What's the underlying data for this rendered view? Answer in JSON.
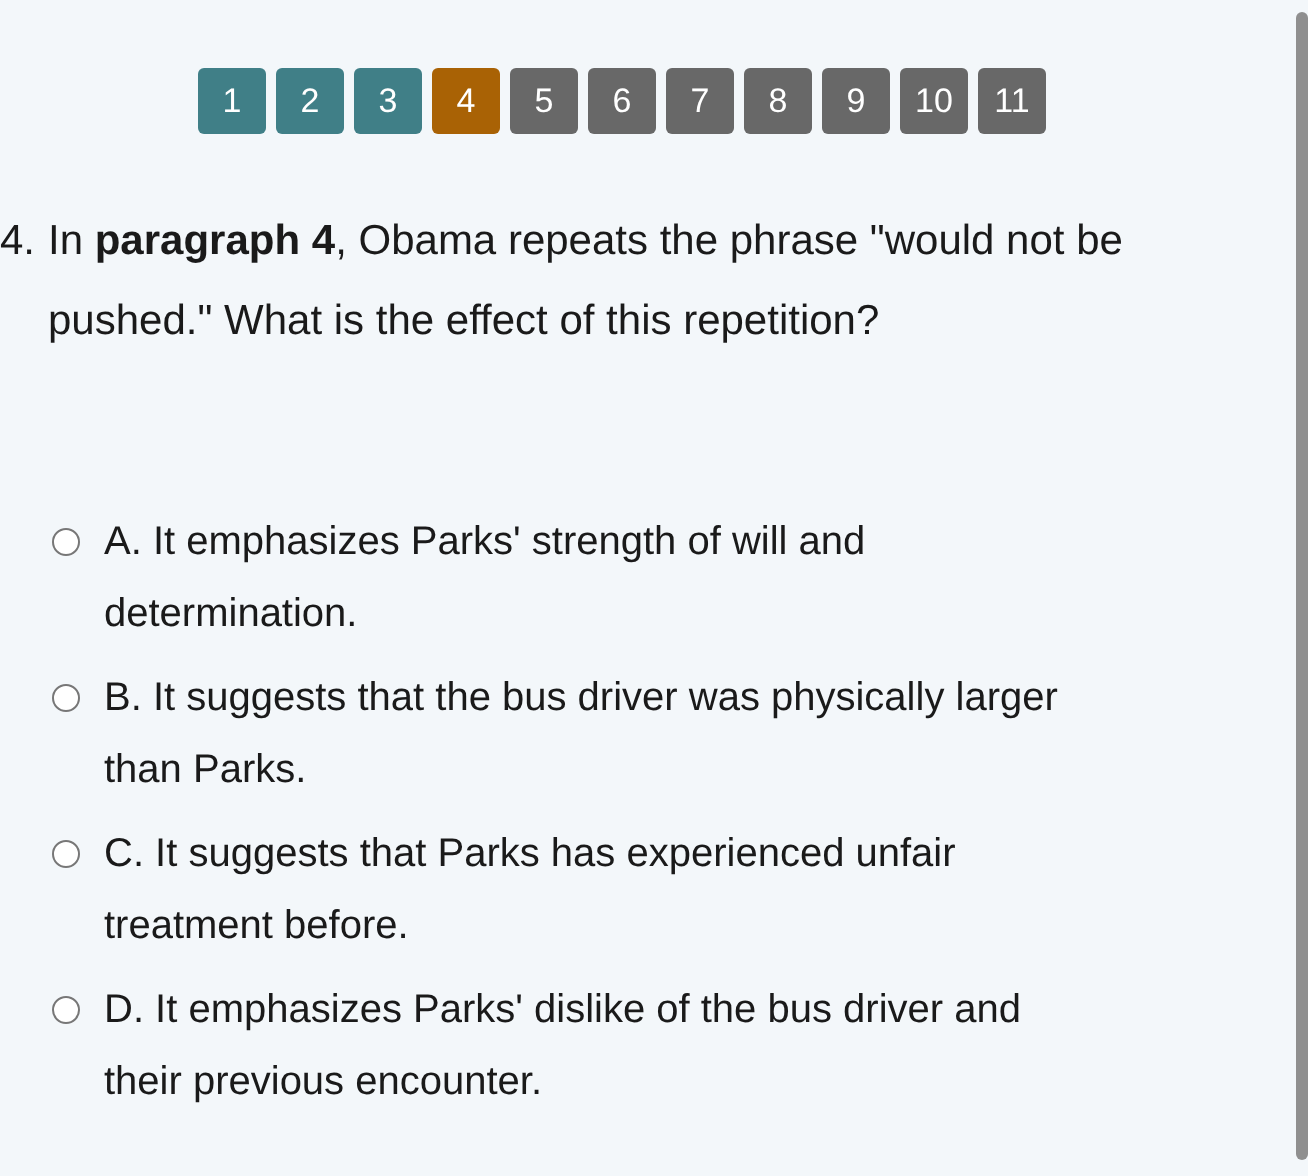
{
  "question_nav": [
    {
      "label": "1",
      "answered": true,
      "selected": false
    },
    {
      "label": "2",
      "answered": true,
      "selected": false
    },
    {
      "label": "3",
      "answered": true,
      "selected": false
    },
    {
      "label": "4",
      "answered": false,
      "selected": true
    },
    {
      "label": "5",
      "answered": false,
      "selected": false
    },
    {
      "label": "6",
      "answered": false,
      "selected": false
    },
    {
      "label": "7",
      "answered": false,
      "selected": false
    },
    {
      "label": "8",
      "answered": false,
      "selected": false
    },
    {
      "label": "9",
      "answered": false,
      "selected": false
    },
    {
      "label": "10",
      "answered": false,
      "selected": false
    },
    {
      "label": "11",
      "answered": false,
      "selected": false
    }
  ],
  "question": {
    "number": "4.",
    "text": "In **paragraph 4**, Obama repeats the phrase \"would not be pushed.\" What is the effect of this repetition?"
  },
  "options": [
    {
      "text": "A. It emphasizes Parks' strength of will and determination.",
      "selected": false
    },
    {
      "text": "B. It suggests that the bus driver was physically larger than Parks.",
      "selected": false
    },
    {
      "text": "C. It suggests that Parks has experienced unfair treatment before.",
      "selected": false
    },
    {
      "text": "D. It emphasizes Parks' dislike of the bus driver and their previous encounter.",
      "selected": false
    }
  ]
}
